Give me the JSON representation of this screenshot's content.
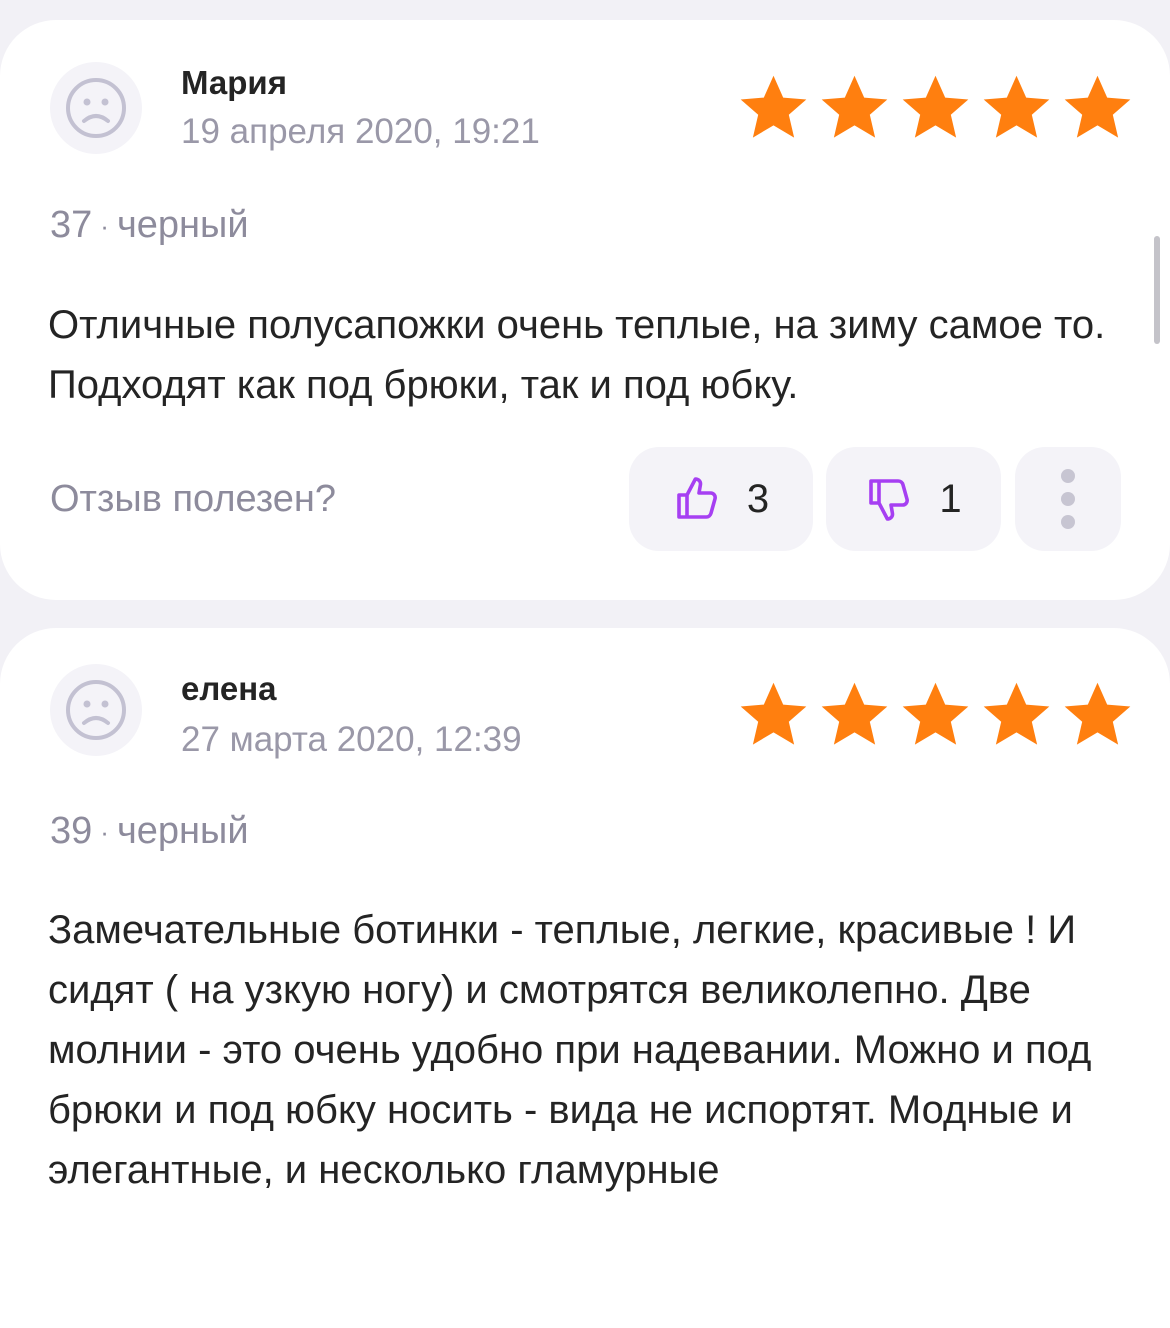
{
  "reviews": [
    {
      "author": "Мария",
      "date": "19 апреля 2020, 19:21",
      "rating": 5,
      "size": "37",
      "separator": "·",
      "color": "черный",
      "text": "Отличные полусапожки очень теплые, на зиму самое то. Подходят как под брюки, так и под юбку.",
      "helpful_label": "Отзыв полезен?",
      "likes": "3",
      "dislikes": "1"
    },
    {
      "author": "елена",
      "date": "27 марта 2020, 12:39",
      "rating": 5,
      "size": "39",
      "separator": "·",
      "color": "черный",
      "text": "Замечательные ботинки - теплые, легкие, красивые ! И сидят ( на узкую ногу) и смотрятся великолепно. Две молнии - это очень удобно при надевании. Можно и под брюки и под юбку носить - вида не испортят. Модные и элегантные, и несколько гламурные"
    }
  ],
  "icons": {
    "avatar": "sad-face-icon",
    "star": "star-icon",
    "like": "thumbs-up-icon",
    "dislike": "thumbs-down-icon",
    "more": "more-vertical-icon"
  },
  "colors": {
    "star": "#ff7f0f",
    "vote_icon": "#a63ff2",
    "background": "#f2f1f6",
    "card": "#ffffff",
    "secondary_text": "#8d8b9c"
  }
}
